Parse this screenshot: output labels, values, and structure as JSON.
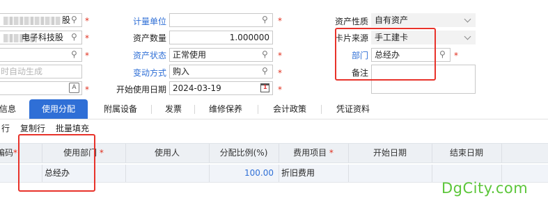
{
  "form": {
    "left_col": {
      "row1_value_suffix": "股",
      "row2_value_suffix": "电子科技股",
      "row4_placeholder": "时自动生成"
    },
    "mid_col": {
      "unit_label": "计量单位",
      "qty_label": "资产数量",
      "qty_value": "1.000000",
      "status_label": "资产状态",
      "status_value": "正常使用",
      "change_label": "变动方式",
      "change_value": "购入",
      "start_label": "开始使用日期",
      "start_value": "2024-03-19"
    },
    "right_col": {
      "nature_label": "资产性质",
      "nature_value": "自有资产",
      "source_label": "卡片来源",
      "source_value": "手工建卡",
      "dept_label": "部门",
      "dept_value": "总经办",
      "remark_label": "备注"
    },
    "required_mark": "*",
    "field_icon_label": "A"
  },
  "tabs": [
    "信息",
    "使用分配",
    "附属设备",
    "发票",
    "维修保养",
    "会计政策",
    "凭证资料"
  ],
  "toolbar": [
    "行",
    "复制行",
    "批量填充"
  ],
  "grid": {
    "headers": [
      "编码",
      "使用部门",
      "使用人",
      "分配比例(%)",
      "费用项目",
      "开始日期",
      "结束日期"
    ],
    "row": {
      "dept": "总经办",
      "person": "",
      "ratio": "100.00",
      "expense": "折旧费用",
      "start": "",
      "end": ""
    }
  },
  "watermark": "DgCity.com",
  "colors": {
    "accent": "#2f6fd6",
    "required": "#e0301e",
    "highlight_box": "#e8322a",
    "watermark": "#5cc63a"
  }
}
